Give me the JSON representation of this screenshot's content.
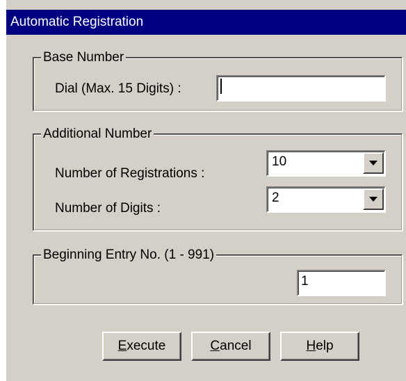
{
  "window": {
    "title": "Automatic Registration"
  },
  "base_number": {
    "group_title": "Base Number",
    "dial_label": "Dial (Max. 15 Digits) :",
    "dial_value": ""
  },
  "additional_number": {
    "group_title": "Additional Number",
    "registrations_label": "Number of Registrations :",
    "registrations_value": "10",
    "digits_label": "Number of Digits :",
    "digits_value": "2"
  },
  "beginning_entry": {
    "group_title": "Beginning Entry No. (1 - 991)",
    "value": "1"
  },
  "buttons": {
    "execute": {
      "accel": "E",
      "rest": "xecute"
    },
    "cancel": {
      "accel": "C",
      "rest": "ancel"
    },
    "help": {
      "accel": "H",
      "rest": "elp"
    }
  },
  "icons": {
    "dropdown": "chevron-down-icon"
  }
}
